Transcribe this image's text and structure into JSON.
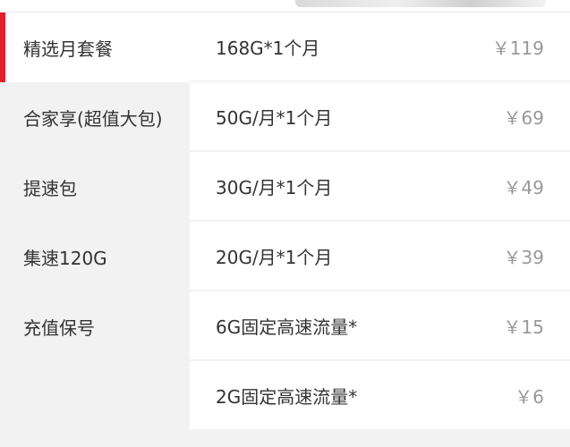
{
  "sidebar": {
    "active_color": "#e01e2d",
    "items": [
      {
        "label": "精选月套餐",
        "active": true
      },
      {
        "label": "合家享(超值大包)",
        "active": false
      },
      {
        "label": "提速包",
        "active": false
      },
      {
        "label": "集速120G",
        "active": false
      },
      {
        "label": "充值保号",
        "active": false
      }
    ]
  },
  "plans": [
    {
      "name": "168G*1个月",
      "price": "￥119"
    },
    {
      "name": "50G/月*1个月",
      "price": "￥69"
    },
    {
      "name": "30G/月*1个月",
      "price": "￥49"
    },
    {
      "name": "20G/月*1个月",
      "price": "￥39"
    },
    {
      "name": "6G固定高速流量*",
      "price": "￥15"
    },
    {
      "name": "2G固定高速流量*",
      "price": "￥6"
    }
  ]
}
